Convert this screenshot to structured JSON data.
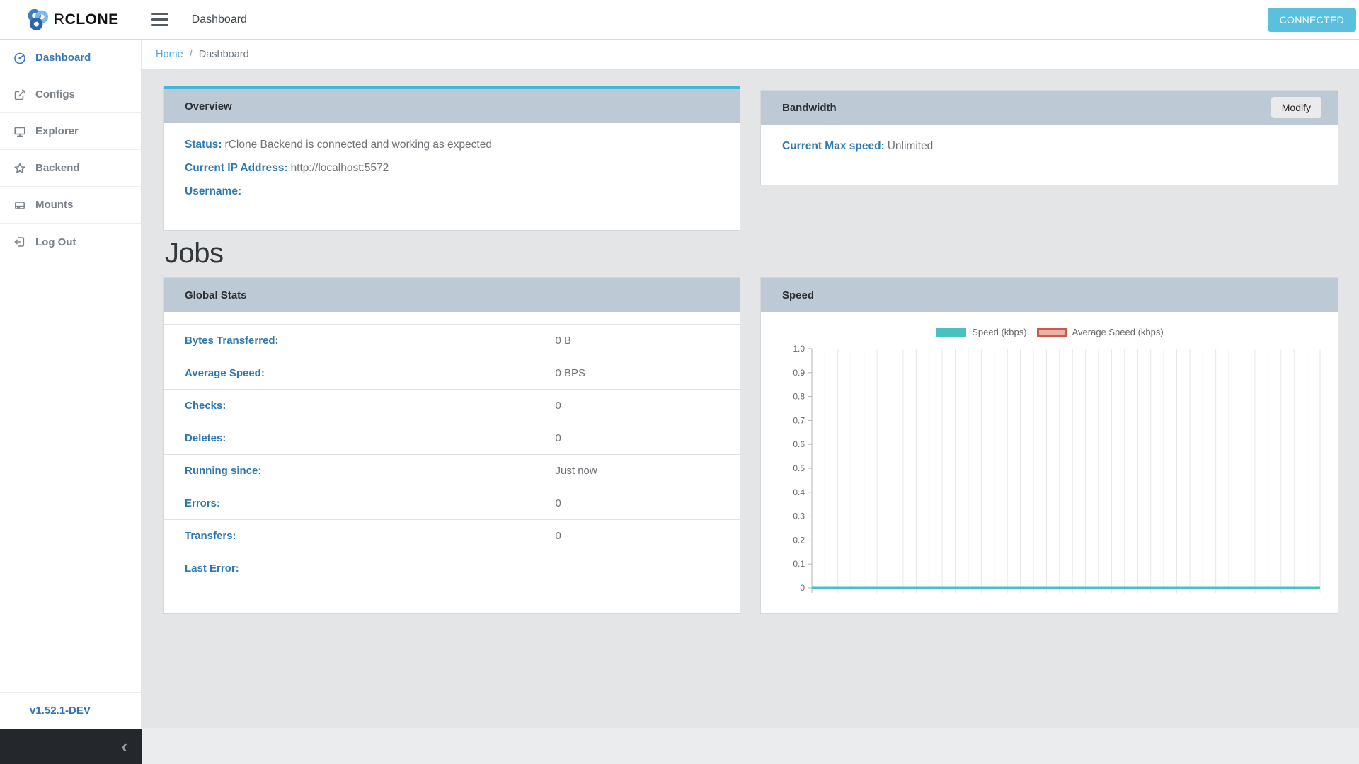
{
  "header": {
    "brand_r": "R",
    "brand_rest": "CLONE",
    "title": "Dashboard",
    "status_button": "CONNECTED",
    "status_color": "#5bc0de"
  },
  "sidebar": {
    "items": [
      {
        "label": "Dashboard",
        "icon": "tachometer-icon",
        "active": true
      },
      {
        "label": "Configs",
        "icon": "edit-icon",
        "active": false
      },
      {
        "label": "Explorer",
        "icon": "desktop-icon",
        "active": false
      },
      {
        "label": "Backend",
        "icon": "star-icon",
        "active": false
      },
      {
        "label": "Mounts",
        "icon": "hdd-icon",
        "active": false
      },
      {
        "label": "Log Out",
        "icon": "sign-out-icon",
        "active": false
      }
    ],
    "version": "v1.52.1-DEV",
    "collapse_icon": "‹"
  },
  "breadcrumb": {
    "home": "Home",
    "separator": "/",
    "current": "Dashboard"
  },
  "overview": {
    "title": "Overview",
    "accent_color": "#43b7d8",
    "fields": [
      {
        "label": "Status:",
        "value": "rClone Backend is connected and working as expected"
      },
      {
        "label": "Current IP Address:",
        "value": "http://localhost:5572"
      },
      {
        "label": "Username:",
        "value": ""
      }
    ]
  },
  "bandwidth": {
    "title": "Bandwidth",
    "modify_button": "Modify",
    "fields": [
      {
        "label": "Current Max speed:",
        "value": "Unlimited"
      }
    ]
  },
  "jobs": {
    "heading": "Jobs",
    "global_stats": {
      "title": "Global Stats",
      "rows": [
        {
          "label": "Bytes Transferred:",
          "value": "0 B"
        },
        {
          "label": "Average Speed:",
          "value": "0 BPS"
        },
        {
          "label": "Checks:",
          "value": "0"
        },
        {
          "label": "Deletes:",
          "value": "0"
        },
        {
          "label": "Running since:",
          "value": "Just now"
        },
        {
          "label": "Errors:",
          "value": "0"
        },
        {
          "label": "Transfers:",
          "value": "0"
        },
        {
          "label": "Last Error:",
          "value": ""
        }
      ]
    },
    "speed_card_title": "Speed"
  },
  "chart_data": {
    "type": "line",
    "title": "Speed",
    "xlabel": "",
    "ylabel": "",
    "ylim": [
      0,
      1.0
    ],
    "yticks": [
      "1.0",
      "0.9",
      "0.8",
      "0.7",
      "0.6",
      "0.5",
      "0.4",
      "0.3",
      "0.2",
      "0.1",
      "0"
    ],
    "x_tick_labels_visible": false,
    "grid": "vertical-only",
    "grid_color": "#e6e6e6",
    "axis_color": "#b3b3b3",
    "tick_text_color": "#666666",
    "legend_position": "top-center",
    "series": [
      {
        "name": "Speed (kbps)",
        "line_color": "#4bc0c0",
        "swatch_fill": "#4bc0c0",
        "swatch_border": "#4bc0c0",
        "values": [
          0,
          0,
          0,
          0,
          0,
          0,
          0,
          0,
          0,
          0,
          0,
          0,
          0,
          0,
          0,
          0,
          0,
          0,
          0,
          0,
          0,
          0,
          0,
          0,
          0,
          0,
          0,
          0,
          0,
          0,
          0,
          0,
          0,
          0,
          0,
          0,
          0,
          0,
          0,
          0
        ]
      },
      {
        "name": "Average Speed (kbps)",
        "line_color": "#c9584f",
        "swatch_fill": "#eab3a7",
        "swatch_border": "#c9584f",
        "values": [
          0,
          0,
          0,
          0,
          0,
          0,
          0,
          0,
          0,
          0,
          0,
          0,
          0,
          0,
          0,
          0,
          0,
          0,
          0,
          0,
          0,
          0,
          0,
          0,
          0,
          0,
          0,
          0,
          0,
          0,
          0,
          0,
          0,
          0,
          0,
          0,
          0,
          0,
          0,
          0
        ]
      }
    ]
  }
}
